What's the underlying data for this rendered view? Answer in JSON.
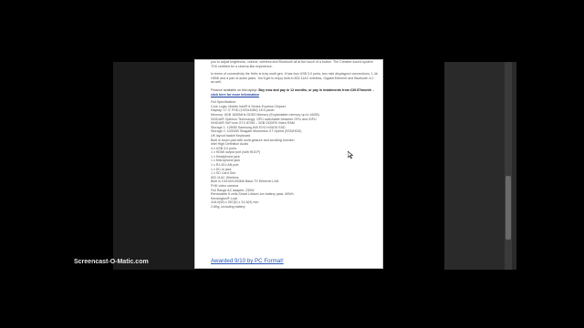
{
  "review": {
    "intro_paragraph_1": "you to adjust brightness, volume, wireless and Bluetooth all at the touch of a button. The Creative sound system THX certified for a cinema-like experience.",
    "intro_paragraph_2": "In terms of connectivity the Helix is truly multi gen. It has four USB 3.0 ports, two mini displayport connections, 1.4b HDMI and a pair of audio jacks. You'll get to enjoy built-in 802.11AC wireless, Gigabit Ethernet and Bluetooth 4.0 as well.",
    "finance": {
      "prefix": "Finance available on this laptop: ",
      "bold_text": "Buy now and pay in 12 months, or pay in instalments from £39.57/month",
      "separator": " – ",
      "link_text": "click here for more information"
    },
    "spec_lines": [
      "Full Specification:",
      "Core Logic: Mobile Intel® 8 Series Express Chipset",
      "Display: 17.3\" FHD (1920x1080) 16:9 panel",
      "Memory: 8GB 1600MHz DDR3 Memory (Expandable memory up to 16GB)",
      "NVIDIA® Optimus Technology: GPU switchable between GPU and iGPU",
      "NVIDIA® GeForce GTX 870M – 3GB GDDR5 Video RAM",
      "Storage 1: 128GB Samsung 840 EVO mSATA SSD",
      "Storage 2: 1000GB Seagate Momentus XT Hybrid (SSD/HDD)",
      "UK layout backlit Keyboard",
      "Built in touch pad with multi-gesture and scrolling function",
      "Intel High Definition Audio",
      "4 x USB 3.0 ports",
      "1 x HDMI output port (with HDCP)",
      "1 x Headphone jack",
      "1 x Microphone jack",
      "1 x RJ-45 LAN port",
      "1 x DC-in jack",
      "1 x SD Card Slot",
      "802.11AC Wireless",
      "Built in 10/100/1000Mb Base-TX Ethernet LAN",
      "FHD video camera",
      "Full Range AC adapter, 230W",
      "Removable 6 cells Smart Lithium-Ion battery pack, 69Wh",
      "Kensington® Lock",
      "418.0(W) x 287(D) x 31.0(H) mm",
      "2.6Kg, including battery"
    ],
    "award_link": "Awarded 9/10 by PC Format!"
  },
  "watermark": "Screencast-O-Matic.com"
}
